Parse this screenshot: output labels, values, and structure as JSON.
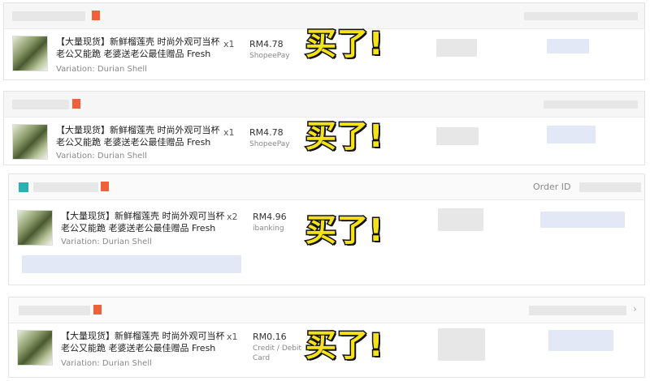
{
  "orders": [
    {
      "title": "【大量现货】新鲜榴莲壳 时尚外观可当杯 老公又能跪 老婆送老公最佳赠品 Fresh D...",
      "variation": "Variation: Durian Shell",
      "qty": "x1",
      "price": "RM4.78",
      "payment": "ShopeePay"
    },
    {
      "title": "【大量现货】新鲜榴莲壳 时尚外观可当杯 老公又能跪 老婆送老公最佳赠品 Fresh D...",
      "variation": "Variation: Durian Shell",
      "qty": "x1",
      "price": "RM4.78",
      "payment": "ShopeePay"
    },
    {
      "title": "【大量现货】新鲜榴莲壳 时尚外观可当杯 老公又能跪 老婆送老公最佳赠品 Fresh D...",
      "variation": "Variation: Durian Shell",
      "qty": "x2",
      "price": "RM4.96",
      "payment": "ibanking",
      "order_id_label": "Order ID"
    },
    {
      "title": "【大量现货】新鲜榴莲壳 时尚外观可当杯 老公又能跪 老婆送老公最佳赠品 Fresh D...",
      "variation": "Variation: Durian Shell",
      "qty": "x1",
      "price": "RM0.16",
      "payment": "Credit / Debit Card"
    }
  ],
  "stamp_text": "买了!",
  "chevron_glyph": "›",
  "colors": {
    "stamp_fill": "#f4e21b",
    "stamp_stroke": "#111111",
    "shop_marker": "#f0603a"
  }
}
